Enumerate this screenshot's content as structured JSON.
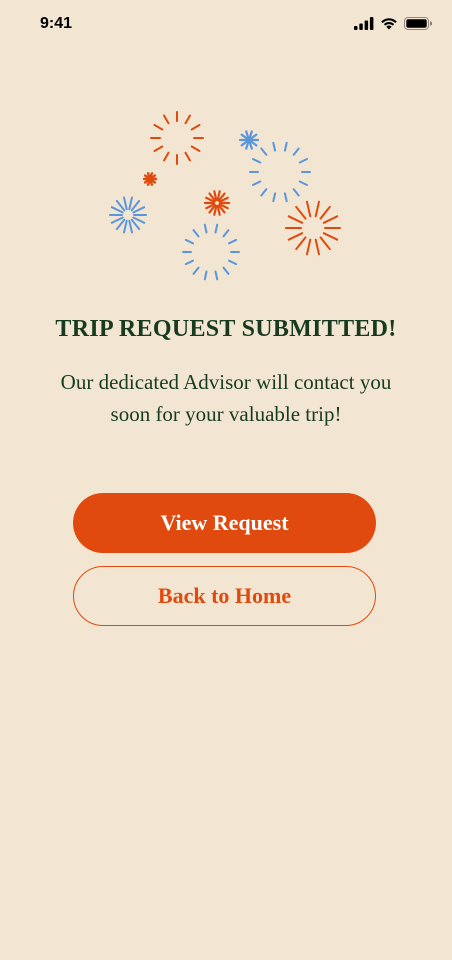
{
  "status_bar": {
    "time": "9:41"
  },
  "colors": {
    "background": "#f2e6d2",
    "accent": "#e04a0f",
    "blue": "#5b96dc",
    "text_dark": "#173a20"
  },
  "confirmation": {
    "title": "TRIP REQUEST SUBMITTED!",
    "message": "Our dedicated Advisor will contact you soon for your valuable trip!"
  },
  "actions": {
    "primary_label": "View Request",
    "secondary_label": "Back to Home"
  }
}
